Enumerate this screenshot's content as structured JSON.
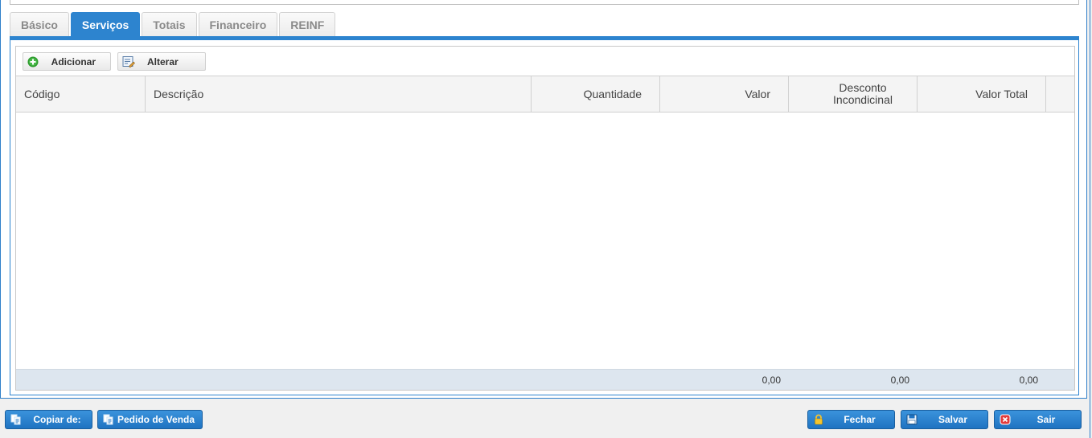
{
  "tabs": [
    "Básico",
    "Serviços",
    "Totais",
    "Financeiro",
    "REINF"
  ],
  "active_tab": "Serviços",
  "toolbar": {
    "add_label": "Adicionar",
    "edit_label": "Alterar"
  },
  "table": {
    "columns": [
      "Código",
      "Descrição",
      "Quantidade",
      "Valor",
      "Desconto Incondicinal",
      "Valor Total"
    ],
    "rows": [],
    "totals": {
      "valor": "0,00",
      "desconto": "0,00",
      "valor_total": "0,00"
    }
  },
  "bottom": {
    "copy_label": "Copiar de:",
    "order_label": "Pedido de Venda",
    "close_label": "Fechar",
    "save_label": "Salvar",
    "exit_label": "Sair"
  },
  "colors": {
    "accent": "#2d84cf",
    "footer_row": "#dde6ef"
  }
}
